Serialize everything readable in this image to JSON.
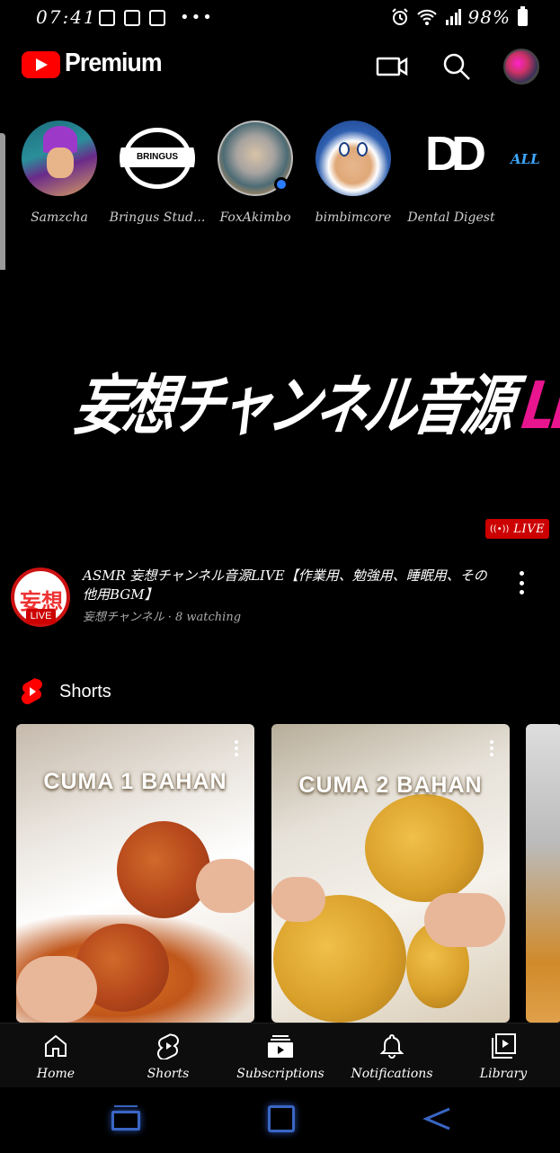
{
  "status_bar": {
    "time": "07:41",
    "battery": "98%",
    "dots": "•••"
  },
  "header": {
    "brand": "Premium"
  },
  "subscriptions": {
    "channels": [
      {
        "name": "Samzcha"
      },
      {
        "name": "Bringus Stud..."
      },
      {
        "name": "FoxAkimbo"
      },
      {
        "name": "bimbimcore"
      },
      {
        "name": "Dental Digest"
      }
    ],
    "bringus_logo_text": "BRINGUS Studios",
    "dental_logo_text": "DD",
    "all_label": "ALL"
  },
  "live_video": {
    "thumbnail_title": "妄想チャンネル音源",
    "thumbnail_live_word": "LIVE",
    "badge": "LIVE",
    "title": "ASMR 妄想チャンネル音源LIVE【作業用、勉強用、睡眠用、その他用BGM】",
    "subtitle": "妄想チャンネル · 8 watching",
    "channel_avatar_text": "妄想",
    "channel_live_pill": "LIVE"
  },
  "shorts": {
    "section_title": "Shorts",
    "items": [
      {
        "caption": "CUMA 1 BAHAN"
      },
      {
        "caption": "CUMA 2 BAHAN"
      }
    ]
  },
  "bottom_nav": {
    "items": [
      {
        "label": "Home",
        "icon": "home-icon"
      },
      {
        "label": "Shorts",
        "icon": "shorts-icon"
      },
      {
        "label": "Subscriptions",
        "icon": "subscriptions-icon"
      },
      {
        "label": "Notifications",
        "icon": "bell-icon"
      },
      {
        "label": "Library",
        "icon": "library-icon"
      }
    ]
  },
  "colors": {
    "brand_red": "#ff0000",
    "live_red": "#cc0000",
    "link_blue": "#3ea6ff",
    "live_pink": "#e8158f",
    "android_nav_blue": "#3a66c4"
  }
}
